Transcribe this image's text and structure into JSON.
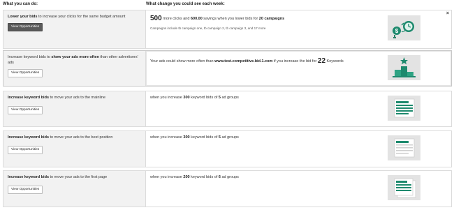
{
  "headers": {
    "left": "What you can do:",
    "right": "What change you could see each week:"
  },
  "rows": [
    {
      "title_bold": "Lower your bids",
      "title_rest": " to increase your clicks for the same budget amount",
      "button": "View Opportunities",
      "msg_num": "500",
      "msg_a": " more clicks and ",
      "msg_b": "600.00",
      "msg_c": " savings when you lower bids for ",
      "msg_d": "20 campaigns",
      "sub": "Campaigns include tb campaign one, tb campaign 2, tb campaign 3, and 17 more",
      "close": "×"
    },
    {
      "title_a": "Increase keyword bids",
      "title_b": " to ",
      "title_c": "show your ads more often",
      "title_d": " than other advertisers' ads",
      "button": "View Opportunities",
      "msg_a": "Your ads could show more often than ",
      "msg_b": "www.test.competitive.bid.1.com",
      "msg_c": " if you increase the bid for ",
      "msg_num": "22",
      "msg_d": " Keywords"
    },
    {
      "title_bold": "Increase keyword bids",
      "title_rest": " to move your ads to the mainline",
      "button": "View Opportunities",
      "msg_a": "when you increase ",
      "msg_b": "300",
      "msg_c": " keyword bids of ",
      "msg_d": "5",
      "msg_e": " ad groups"
    },
    {
      "title_bold": "Increase keyword bids",
      "title_rest": " to move your ads to the best position",
      "button": "View Opportunities",
      "msg_a": "when you increase ",
      "msg_b": "300",
      "msg_c": " keyword bids of ",
      "msg_d": "5",
      "msg_e": " ad groups"
    },
    {
      "title_bold": "Increase keyword bids",
      "title_rest": " to move your ads to the first page",
      "button": "View Opportunities",
      "msg_a": "when you increase ",
      "msg_b": "200",
      "msg_c": " keyword bids of ",
      "msg_d": "6",
      "msg_e": " ad groups"
    }
  ],
  "colors": {
    "accent": "#1e8a6e",
    "illus_bg": "#e3e3e3",
    "panel_bg": "#f2f2f2"
  },
  "icons": [
    "savings-clock-icon",
    "podium-star-icon",
    "mainline-ads-icon",
    "best-position-icon",
    "first-page-icon"
  ]
}
